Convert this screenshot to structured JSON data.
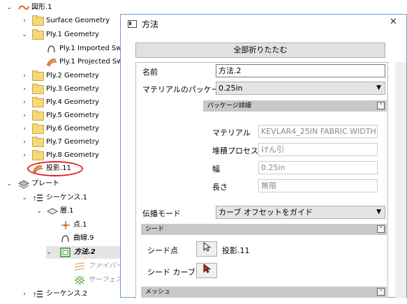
{
  "tree": {
    "root_label": "図形.1",
    "items": [
      {
        "label": "Surface Geometry"
      },
      {
        "label": "Ply.1 Geometry"
      },
      {
        "label": "Ply.1 Imported Sw"
      },
      {
        "label": "Ply.1 Projected Sw"
      },
      {
        "label": "Ply.2 Geometry"
      },
      {
        "label": "Ply.3 Geometry"
      },
      {
        "label": "Ply.4 Geometry"
      },
      {
        "label": "Ply.5 Geometry"
      },
      {
        "label": "Ply.6 Geometry"
      },
      {
        "label": "Ply.7 Geometry"
      },
      {
        "label": "Ply.8 Geometry"
      },
      {
        "label": "投影.11"
      },
      {
        "label": "プレート"
      },
      {
        "label": "シーケンス.1"
      },
      {
        "label": "層.1"
      },
      {
        "label": "点.1"
      },
      {
        "label": "曲線.9"
      },
      {
        "label": "方法.2"
      },
      {
        "label": "ファイバー"
      },
      {
        "label": "サーフェス"
      },
      {
        "label": "シーケンス.2"
      }
    ]
  },
  "dialog": {
    "title": "方法",
    "close_glyph": "✕",
    "collapse_all_label": "全部折りたたむ",
    "name_label": "名前",
    "name_value": "方法.2",
    "package_label": "マテリアルのパッケージ",
    "package_value": "0.25in",
    "package_details_header": "パッケージ詳細",
    "material_label": "マテリアル",
    "material_value": "KEVLAR4_25IN FABRIC WIDTH",
    "process_label": "堆積プロセス",
    "process_value": "けん引",
    "width_label": "幅",
    "width_value": "0.25in",
    "length_label": "長さ",
    "length_value": "無限",
    "propagation_label": "伝播モード",
    "propagation_value": "カーブ オフセットをガイド",
    "seed_header": "シード",
    "seed_point_label": "シード点",
    "seed_point_value": "投影.11",
    "seed_curve_label": "シード カーブ",
    "mesh_header": "メッシュ"
  }
}
